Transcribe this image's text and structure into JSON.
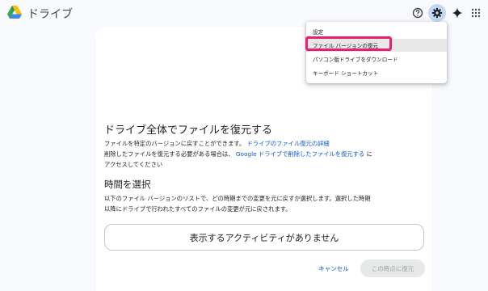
{
  "header": {
    "app_title": "ドライブ",
    "icons": [
      "google-drive-logo",
      "help-icon",
      "settings-gear-icon",
      "gemini-sparkle-icon",
      "apps-grid-icon"
    ]
  },
  "settings_menu": {
    "items": [
      {
        "label": "設定",
        "highlighted": false
      },
      {
        "label": "ファイル バージョンの復元",
        "highlighted": true
      },
      {
        "label": "パソコン版ドライブをダウンロード",
        "highlighted": false
      },
      {
        "label": "キーボード ショートカット",
        "highlighted": false
      }
    ],
    "highlight_color": "#ea1f6d"
  },
  "dialog": {
    "title": "ドライブ全体でファイルを復元する",
    "line1_text": "ファイルを特定のバージョンに戻すことができます。",
    "line1_link": "ドライブのファイル復元の詳細",
    "line2_text": "削除したファイルを復元する必要がある場合は、",
    "line2_link": "Google ドライブで削除したファイルを復元する",
    "line2_suffix": "に",
    "line3_text": "アクセスしてください",
    "section_title": "時間を選択",
    "section_line1": "以下のファイル バージョンのリストで、どの時期までの変更を元に戻すか選択します。選択した時期",
    "section_line2": "以降にドライブで行われたすべてのファイルの変更が元に戻されます。",
    "empty_message": "表示するアクティビティがありません",
    "cancel_label": "キャンセル",
    "restore_label": "この時点に復元"
  },
  "colors": {
    "accent": "#0b57d0",
    "page_bg": "#f8fafd",
    "gear_active_bg": "#c2d8f5"
  }
}
